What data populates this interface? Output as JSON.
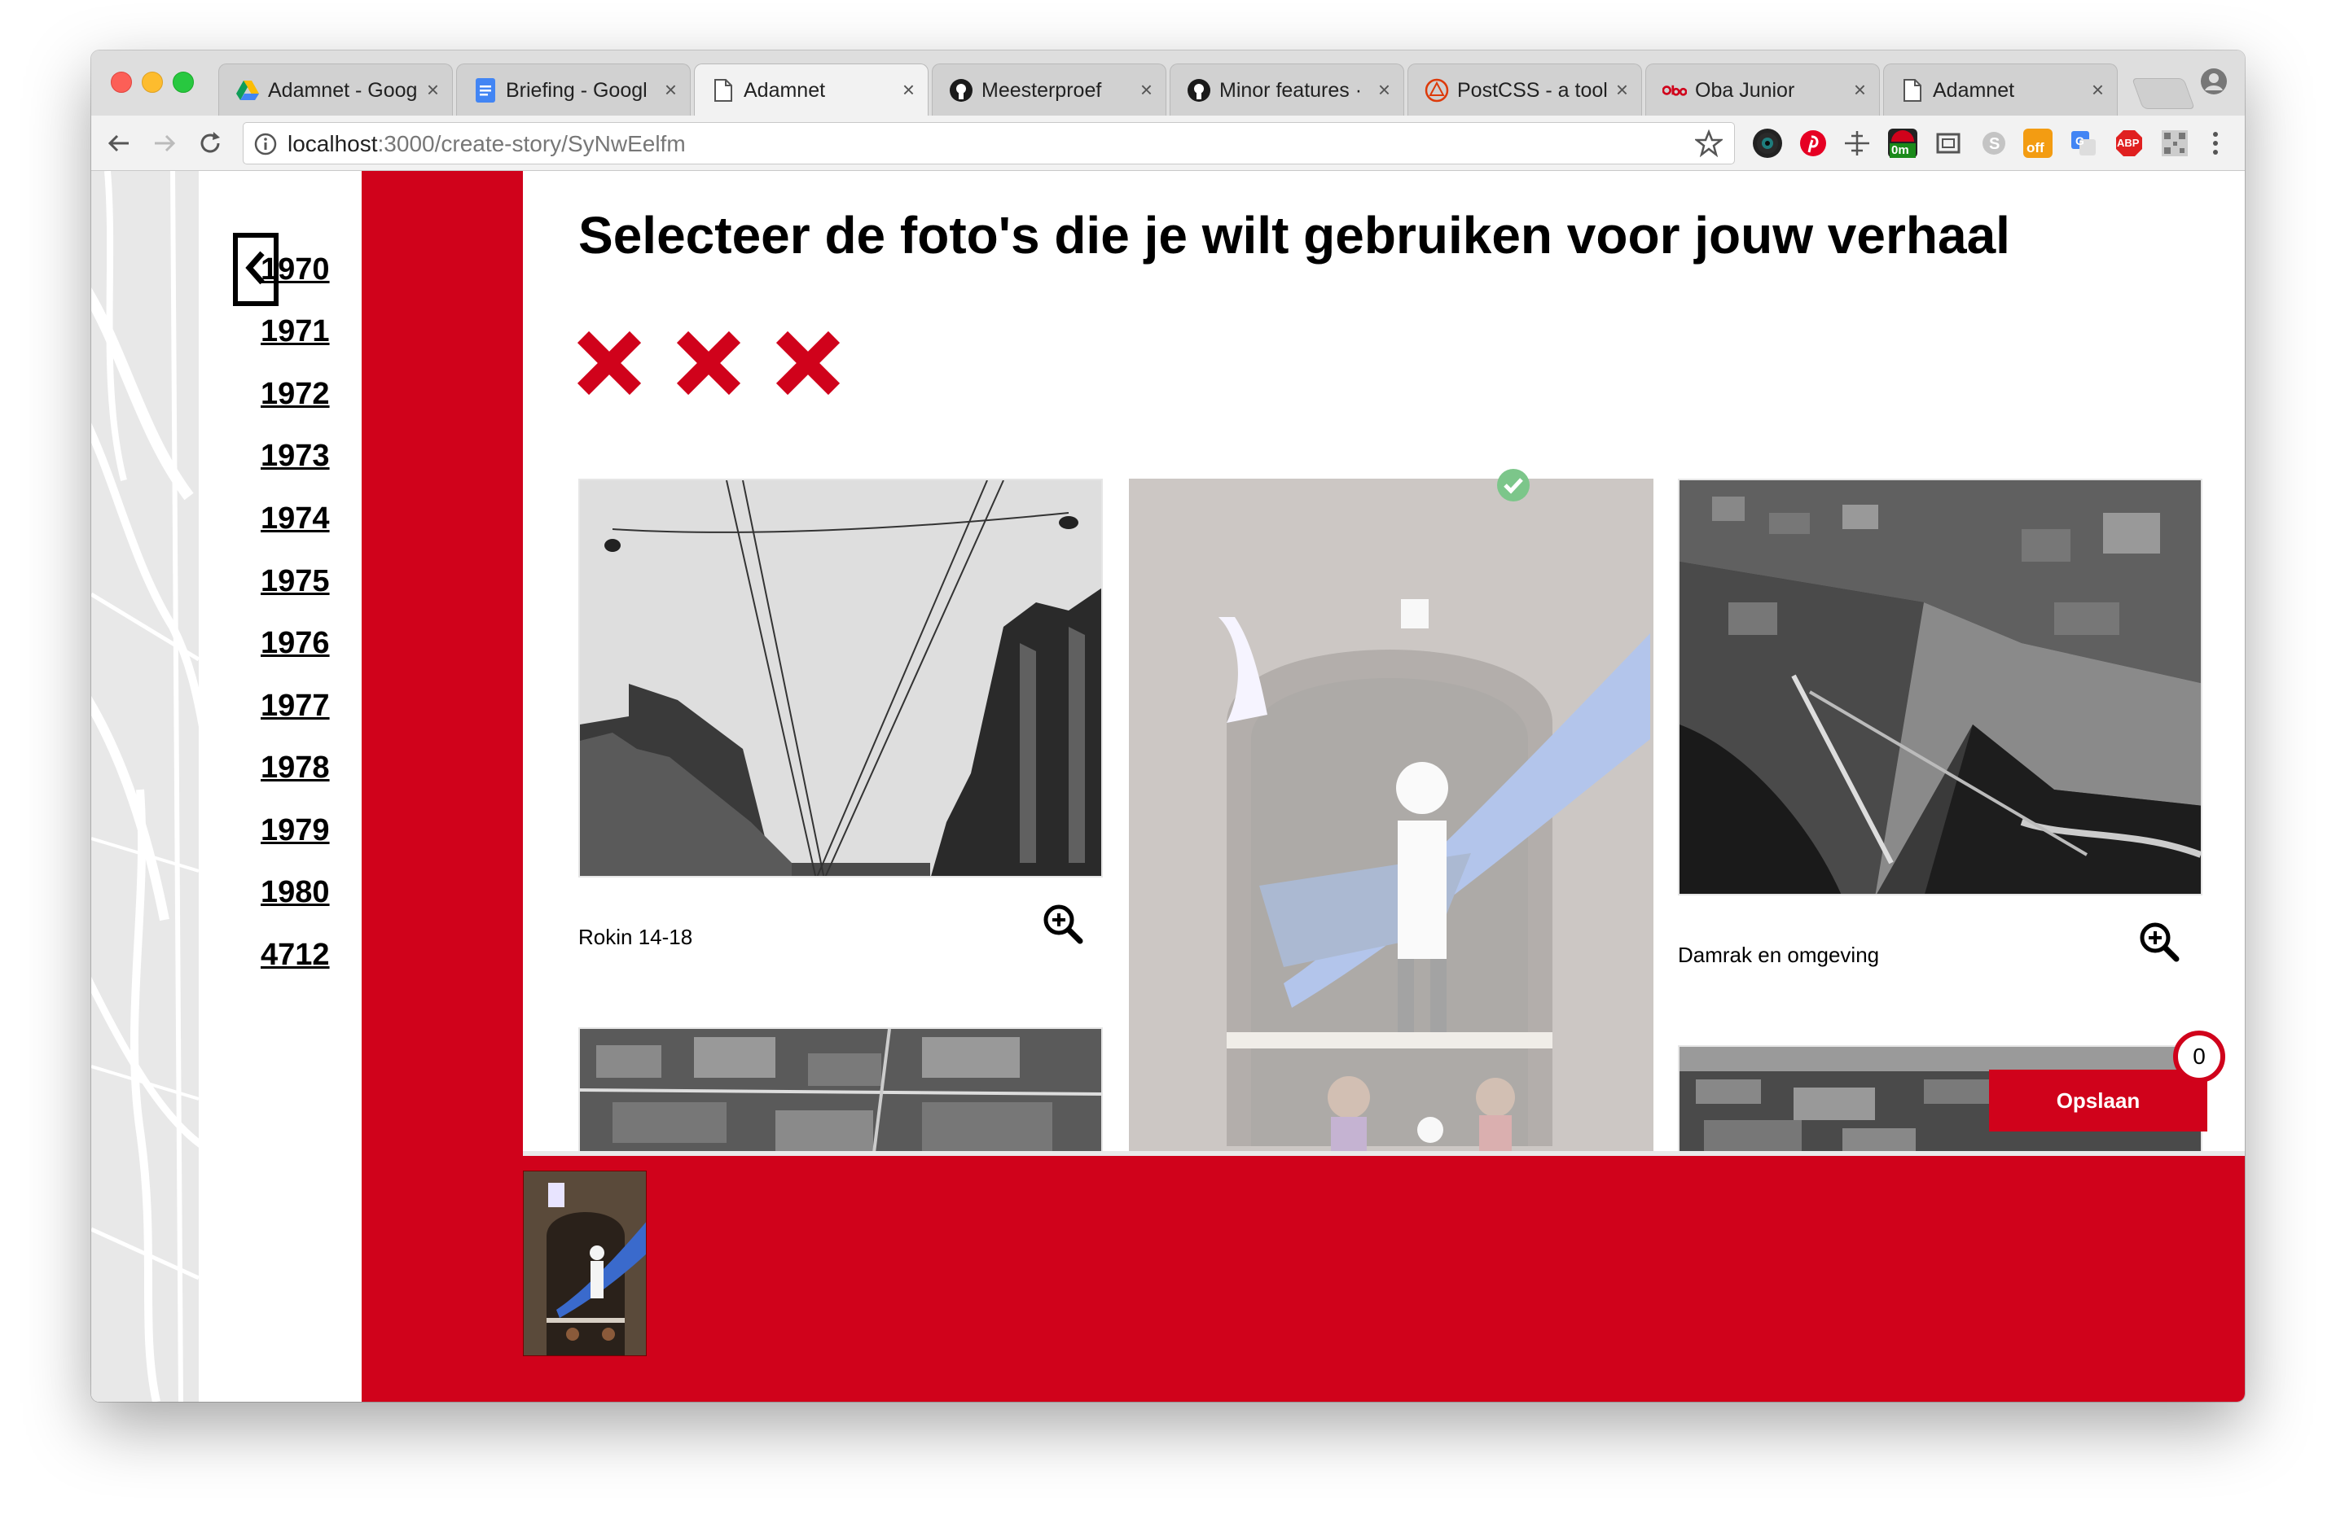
{
  "browser": {
    "tabs": [
      {
        "label": "Adamnet - Goog",
        "icon": "google-drive-icon"
      },
      {
        "label": "Briefing - Googl",
        "icon": "google-docs-icon"
      },
      {
        "label": "Adamnet",
        "icon": "page-icon",
        "active": true
      },
      {
        "label": "Meesterproef",
        "icon": "github-icon"
      },
      {
        "label": "Minor features ·",
        "icon": "github-icon"
      },
      {
        "label": "PostCSS - a tool",
        "icon": "postcss-icon"
      },
      {
        "label": "Oba Junior",
        "icon": "oba-icon"
      },
      {
        "label": "Adamnet",
        "icon": "page-icon"
      }
    ],
    "close_glyph": "×",
    "url_host": "localhost",
    "url_path": ":3000/create-story/SyNwEelfm",
    "extensions": {
      "timer_badge": "0m",
      "off_badge": "off",
      "abp_badge": "ABP"
    }
  },
  "sidebar": {
    "years": [
      "1970",
      "1971",
      "1972",
      "1973",
      "1974",
      "1975",
      "1976",
      "1977",
      "1978",
      "1979",
      "1980",
      "4712"
    ]
  },
  "main": {
    "title": "Selecteer de foto's die je wilt gebruiken voor jouw verhaal",
    "photos": [
      {
        "caption": "Rokin 14-18",
        "selected": false
      },
      {
        "caption": "",
        "selected": true
      },
      {
        "caption": "Damrak en omgeving",
        "selected": false
      }
    ]
  },
  "actions": {
    "save_label": "Opslaan",
    "selected_count": "0"
  },
  "colors": {
    "brand_red": "#d0021b",
    "check_green": "#4caf50"
  }
}
